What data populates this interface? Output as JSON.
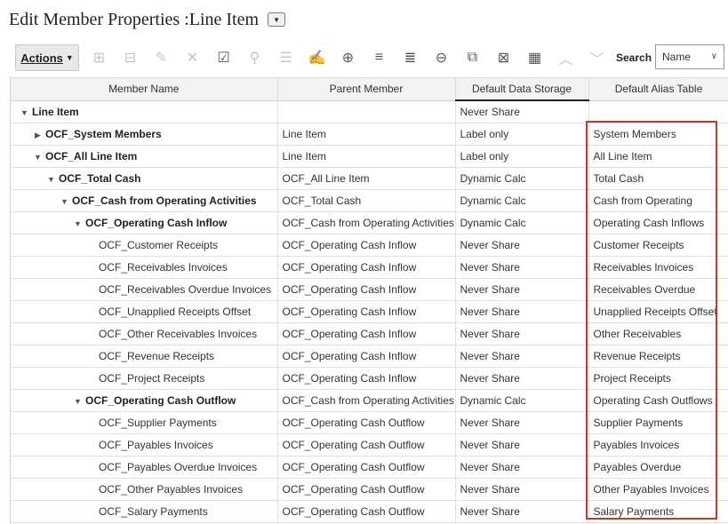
{
  "page": {
    "title": "Edit Member Properties :Line Item",
    "title_menu_icon": "▼"
  },
  "toolbar": {
    "actions_label": "Actions",
    "actions_caret": "▼",
    "icons": [
      {
        "name": "add-child-icon",
        "glyph": "⊞",
        "state": "disabled"
      },
      {
        "name": "add-sibling-icon",
        "glyph": "⊟",
        "state": "disabled"
      },
      {
        "name": "edit-member-icon",
        "glyph": "✎",
        "state": "disabled"
      },
      {
        "name": "delete-icon",
        "glyph": "✕",
        "state": "disabled"
      },
      {
        "name": "validate-icon",
        "glyph": "☑",
        "state": "enabled"
      },
      {
        "name": "pin-icon",
        "glyph": "⚲",
        "state": "disabled"
      },
      {
        "name": "move-icon",
        "glyph": "☰",
        "state": "disabled"
      },
      {
        "name": "edit-formula-icon",
        "glyph": "✍",
        "state": "disabled"
      },
      {
        "name": "zoom-in-icon",
        "glyph": "⊕",
        "state": "enabled"
      },
      {
        "name": "expand-all-icon",
        "glyph": "≡",
        "state": "enabled"
      },
      {
        "name": "collapse-all-icon",
        "glyph": "≣",
        "state": "enabled"
      },
      {
        "name": "zoom-out-icon",
        "glyph": "⊖",
        "state": "enabled"
      },
      {
        "name": "shared-members-icon",
        "glyph": "⧉",
        "state": "enabled"
      },
      {
        "name": "clear-filter-icon",
        "glyph": "⊠",
        "state": "enabled"
      },
      {
        "name": "grid-view-icon",
        "glyph": "▦",
        "state": "enabled"
      },
      {
        "name": "move-up-icon",
        "glyph": "︿",
        "state": "disabled"
      },
      {
        "name": "move-down-icon",
        "glyph": "﹀",
        "state": "disabled"
      }
    ],
    "search_label": "Search",
    "search_value": "Name",
    "search_chevron": "∨"
  },
  "table": {
    "columns": [
      "Member Name",
      "Parent Member",
      "Default Data Storage",
      "Default Alias Table"
    ],
    "rows": [
      {
        "name": "Line Item",
        "parent": "",
        "storage": "Never Share",
        "alias": "",
        "indent": 0,
        "toggle": "▼",
        "bold": true
      },
      {
        "name": "OCF_System Members",
        "parent": "Line Item",
        "storage": "Label only",
        "alias": "System Members",
        "indent": 1,
        "toggle": "▶",
        "bold": true
      },
      {
        "name": "OCF_All Line Item",
        "parent": "Line Item",
        "storage": "Label only",
        "alias": "All Line Item",
        "indent": 1,
        "toggle": "▼",
        "bold": true
      },
      {
        "name": "OCF_Total Cash",
        "parent": "OCF_All Line Item",
        "storage": "Dynamic Calc",
        "alias": "Total Cash",
        "indent": 2,
        "toggle": "▼",
        "bold": true
      },
      {
        "name": "OCF_Cash from Operating Activities",
        "parent": "OCF_Total Cash",
        "storage": "Dynamic Calc",
        "alias": "Cash from Operating",
        "indent": 3,
        "toggle": "▼",
        "bold": true
      },
      {
        "name": "OCF_Operating Cash Inflow",
        "parent": "OCF_Cash from Operating Activities",
        "storage": "Dynamic Calc",
        "alias": "Operating Cash Inflows",
        "indent": 4,
        "toggle": "▼",
        "bold": true
      },
      {
        "name": "OCF_Customer Receipts",
        "parent": "OCF_Operating Cash Inflow",
        "storage": "Never Share",
        "alias": "Customer Receipts",
        "indent": 5,
        "toggle": "",
        "bold": false
      },
      {
        "name": "OCF_Receivables Invoices",
        "parent": "OCF_Operating Cash Inflow",
        "storage": "Never Share",
        "alias": "Receivables Invoices",
        "indent": 5,
        "toggle": "",
        "bold": false
      },
      {
        "name": "OCF_Receivables Overdue Invoices",
        "parent": "OCF_Operating Cash Inflow",
        "storage": "Never Share",
        "alias": "Receivables Overdue",
        "indent": 5,
        "toggle": "",
        "bold": false
      },
      {
        "name": "OCF_Unapplied Receipts Offset",
        "parent": "OCF_Operating Cash Inflow",
        "storage": "Never Share",
        "alias": "Unapplied Receipts Offset",
        "indent": 5,
        "toggle": "",
        "bold": false
      },
      {
        "name": "OCF_Other Receivables Invoices",
        "parent": "OCF_Operating Cash Inflow",
        "storage": "Never Share",
        "alias": "Other Receivables",
        "indent": 5,
        "toggle": "",
        "bold": false
      },
      {
        "name": "OCF_Revenue Receipts",
        "parent": "OCF_Operating Cash Inflow",
        "storage": "Never Share",
        "alias": "Revenue Receipts",
        "indent": 5,
        "toggle": "",
        "bold": false
      },
      {
        "name": "OCF_Project Receipts",
        "parent": "OCF_Operating Cash Inflow",
        "storage": "Never Share",
        "alias": "Project Receipts",
        "indent": 5,
        "toggle": "",
        "bold": false
      },
      {
        "name": "OCF_Operating Cash Outflow",
        "parent": "OCF_Cash from Operating Activities",
        "storage": "Dynamic Calc",
        "alias": "Operating Cash Outflows",
        "indent": 4,
        "toggle": "▼",
        "bold": true
      },
      {
        "name": "OCF_Supplier Payments",
        "parent": "OCF_Operating Cash Outflow",
        "storage": "Never Share",
        "alias": "Supplier Payments",
        "indent": 5,
        "toggle": "",
        "bold": false
      },
      {
        "name": "OCF_Payables Invoices",
        "parent": "OCF_Operating Cash Outflow",
        "storage": "Never Share",
        "alias": "Payables Invoices",
        "indent": 5,
        "toggle": "",
        "bold": false
      },
      {
        "name": "OCF_Payables Overdue Invoices",
        "parent": "OCF_Operating Cash Outflow",
        "storage": "Never Share",
        "alias": "Payables Overdue",
        "indent": 5,
        "toggle": "",
        "bold": false
      },
      {
        "name": "OCF_Other Payables Invoices",
        "parent": "OCF_Operating Cash Outflow",
        "storage": "Never Share",
        "alias": "Other Payables Invoices",
        "indent": 5,
        "toggle": "",
        "bold": false
      },
      {
        "name": "OCF_Salary Payments",
        "parent": "OCF_Operating Cash Outflow",
        "storage": "Never Share",
        "alias": "Salary Payments",
        "indent": 5,
        "toggle": "",
        "bold": false
      }
    ]
  },
  "highlight": {
    "color": "#c0392b"
  }
}
